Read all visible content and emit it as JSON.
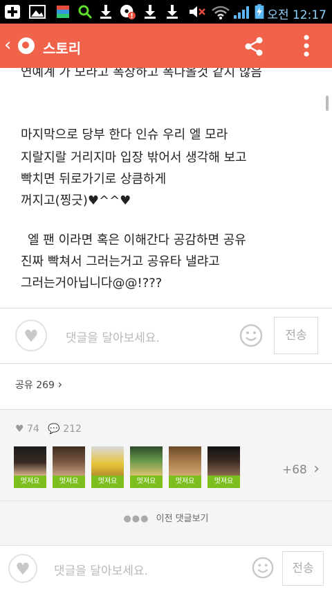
{
  "statusbar": {
    "time": "오전 12:17"
  },
  "appbar": {
    "title": "스토리"
  },
  "story": {
    "lines": [
      "연예계 가 모라고 폭장하고 폭나올것 같지 않음",
      "마지막으로 당부 한다 인슈 우리 엘 모라",
      "지랄지랄 거리지마  입장 밖어서 생각해 보고",
      "빡치면 뒤로가기로 상큼하게",
      "꺼지고(찡긋)♥^^♥",
      "엘 팬 이라면 혹은 이해간다 공감하면 공유",
      "진짜 빡쳐서 그러는거고 공유타 낼랴고",
      "그러는거아닙니다@@!???"
    ]
  },
  "comment_box": {
    "placeholder": "댓글을 달아보세요.",
    "send_label": "전송"
  },
  "share": {
    "label": "공유 269"
  },
  "stats": {
    "likes": "74",
    "comments": "212"
  },
  "likers": {
    "tag": "멋져요",
    "more": "+68"
  },
  "prev_comments": {
    "label": "이전 댓글보기"
  },
  "bottom_comment": {
    "placeholder": "댓글을 달아보세요.",
    "send_label": "전송"
  }
}
